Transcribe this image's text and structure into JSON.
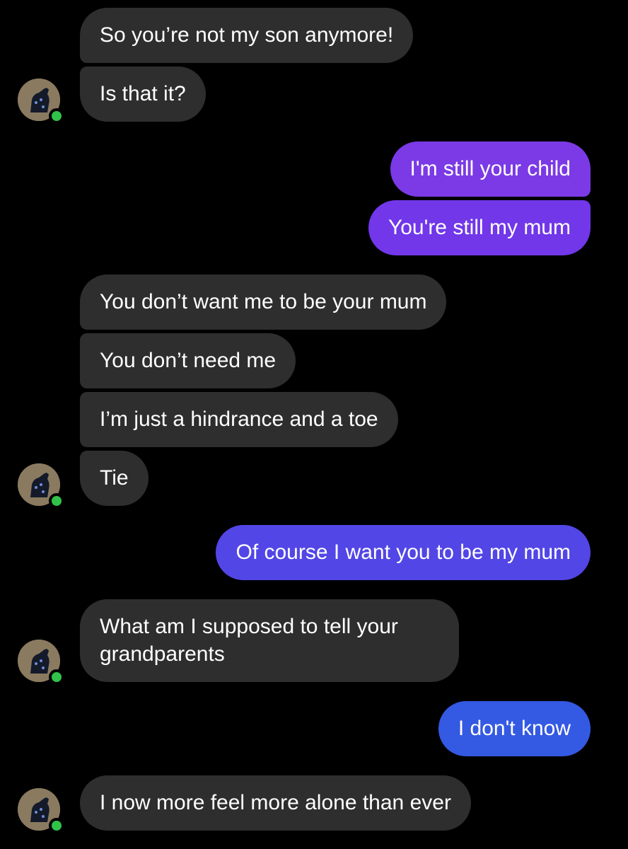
{
  "conversation": {
    "messages": [
      {
        "text": "So you’re not my son anymore!",
        "sender": "mum"
      },
      {
        "text": "Is that it?",
        "sender": "mum"
      },
      {
        "text": "I'm still your child",
        "sender": "me"
      },
      {
        "text": "You're still my mum",
        "sender": "me"
      },
      {
        "text": "You don’t want me to be your mum",
        "sender": "mum"
      },
      {
        "text": "You don’t need me",
        "sender": "mum"
      },
      {
        "text": "I’m just a hindrance and a toe",
        "sender": "mum"
      },
      {
        "text": "Tie",
        "sender": "mum"
      },
      {
        "text": "Of course I want you to be my mum",
        "sender": "me"
      },
      {
        "text": "What am I supposed to tell your grandparents",
        "sender": "mum"
      },
      {
        "text": "I don't know",
        "sender": "me"
      },
      {
        "text": "I now more feel more alone than ever",
        "sender": "mum"
      }
    ]
  },
  "colors": {
    "background": "#000000",
    "incoming_bubble": "#2e2e2e",
    "outgoing_bubble_1": "#7b3ae6",
    "outgoing_bubble_2": "#7137e9",
    "outgoing_bubble_3": "#5246e6",
    "outgoing_bubble_4": "#3459e3",
    "online_dot": "#31c24a"
  },
  "icons": {
    "avatar": "contact-avatar-dog-photo",
    "presence": "online-status-dot"
  }
}
